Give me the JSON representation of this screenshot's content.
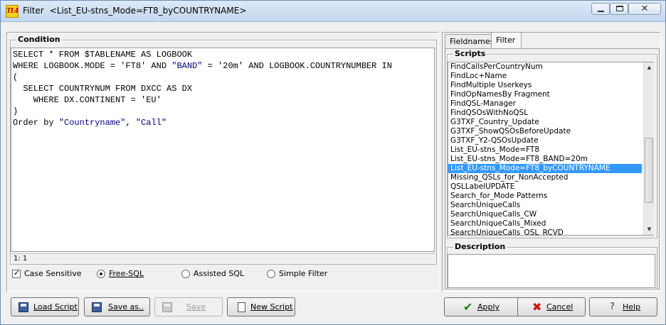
{
  "window": {
    "app_icon_text": "TL4",
    "title_prefix": "Filter",
    "title_detail": "<List_EU-stns_Mode=FT8_byCOUNTRYNAME>",
    "close_glyph": "✕"
  },
  "condition": {
    "caption": "Condition",
    "sql_lines": [
      {
        "before": "SELECT * FROM $TABLENAME AS LOGBOOK",
        "str1": "",
        "mid": "",
        "str2": "",
        "after": ""
      },
      {
        "before": "WHERE LOGBOOK.MODE = 'FT8' AND ",
        "str1": "\"BAND\"",
        "mid": " = '20m' AND LOGBOOK.COUNTRYNUMBER IN",
        "str2": "",
        "after": ""
      },
      {
        "before": "(",
        "str1": "",
        "mid": "",
        "str2": "",
        "after": ""
      },
      {
        "before": "  SELECT COUNTRYNUM FROM DXCC AS DX",
        "str1": "",
        "mid": "",
        "str2": "",
        "after": ""
      },
      {
        "before": "    WHERE DX.CONTINENT = 'EU'",
        "str1": "",
        "mid": "",
        "str2": "",
        "after": ""
      },
      {
        "before": ")",
        "str1": "",
        "mid": "",
        "str2": "",
        "after": ""
      },
      {
        "before": "Order by ",
        "str1": "\"Countryname\"",
        "mid": ", ",
        "str2": "\"Call\"",
        "after": ""
      }
    ],
    "cursor_position": "1: 1",
    "case_sensitive_label": "Case Sensitive",
    "case_sensitive_checked": true,
    "mode_options": [
      {
        "label": "Free-SQL",
        "selected": true
      },
      {
        "label": "Assisted SQL",
        "selected": false
      },
      {
        "label": "Simple Filter",
        "selected": false
      }
    ]
  },
  "tabs": [
    {
      "label": "Fieldnames",
      "active": false
    },
    {
      "label": "Filter",
      "active": true
    }
  ],
  "scripts": {
    "caption": "Scripts",
    "items": [
      "FindCallsPerCountryNum",
      "FindLoc+Name",
      "FindMultiple Userkeys",
      "FindOpNamesBy Fragment",
      "FindQSL-Manager",
      "FindQSOsWithNoQSL",
      "G3TXF_Country_Update",
      "G3TXF_ShowQSOsBeforeUpdate",
      "G3TXF_Y2-QSOsUpdate",
      "List_EU-stns_Mode=FT8",
      "List_EU-stns_Mode=FT8_BAND=20m",
      "List_EU-stns_Mode=FT8_byCOUNTRYNAME",
      "Missing_QSLs_for_NonAccepted",
      "QSLLabelUPDATE",
      "Search_for_Mode Patterns",
      "SearchUniqueCalls",
      "SearchUniqueCalls_CW",
      "SearchUniqueCalls_Mixed",
      "SearchUniqueCalls_QSL_RCVD"
    ],
    "selected_index": 11,
    "scroll_up_glyph": "▲",
    "scroll_down_glyph": "▼"
  },
  "description": {
    "caption": "Description",
    "text": ""
  },
  "buttons": {
    "load_script": "Load Script",
    "save_as": "Save as..",
    "save": "Save",
    "new_script": "New Script",
    "apply": "Apply",
    "cancel": "Cancel",
    "help": "Help"
  },
  "icons": {
    "apply": "✔",
    "cancel": "✖",
    "help": "?"
  },
  "colors": {
    "selection": "#3399ff",
    "string_literal": "#000080"
  }
}
